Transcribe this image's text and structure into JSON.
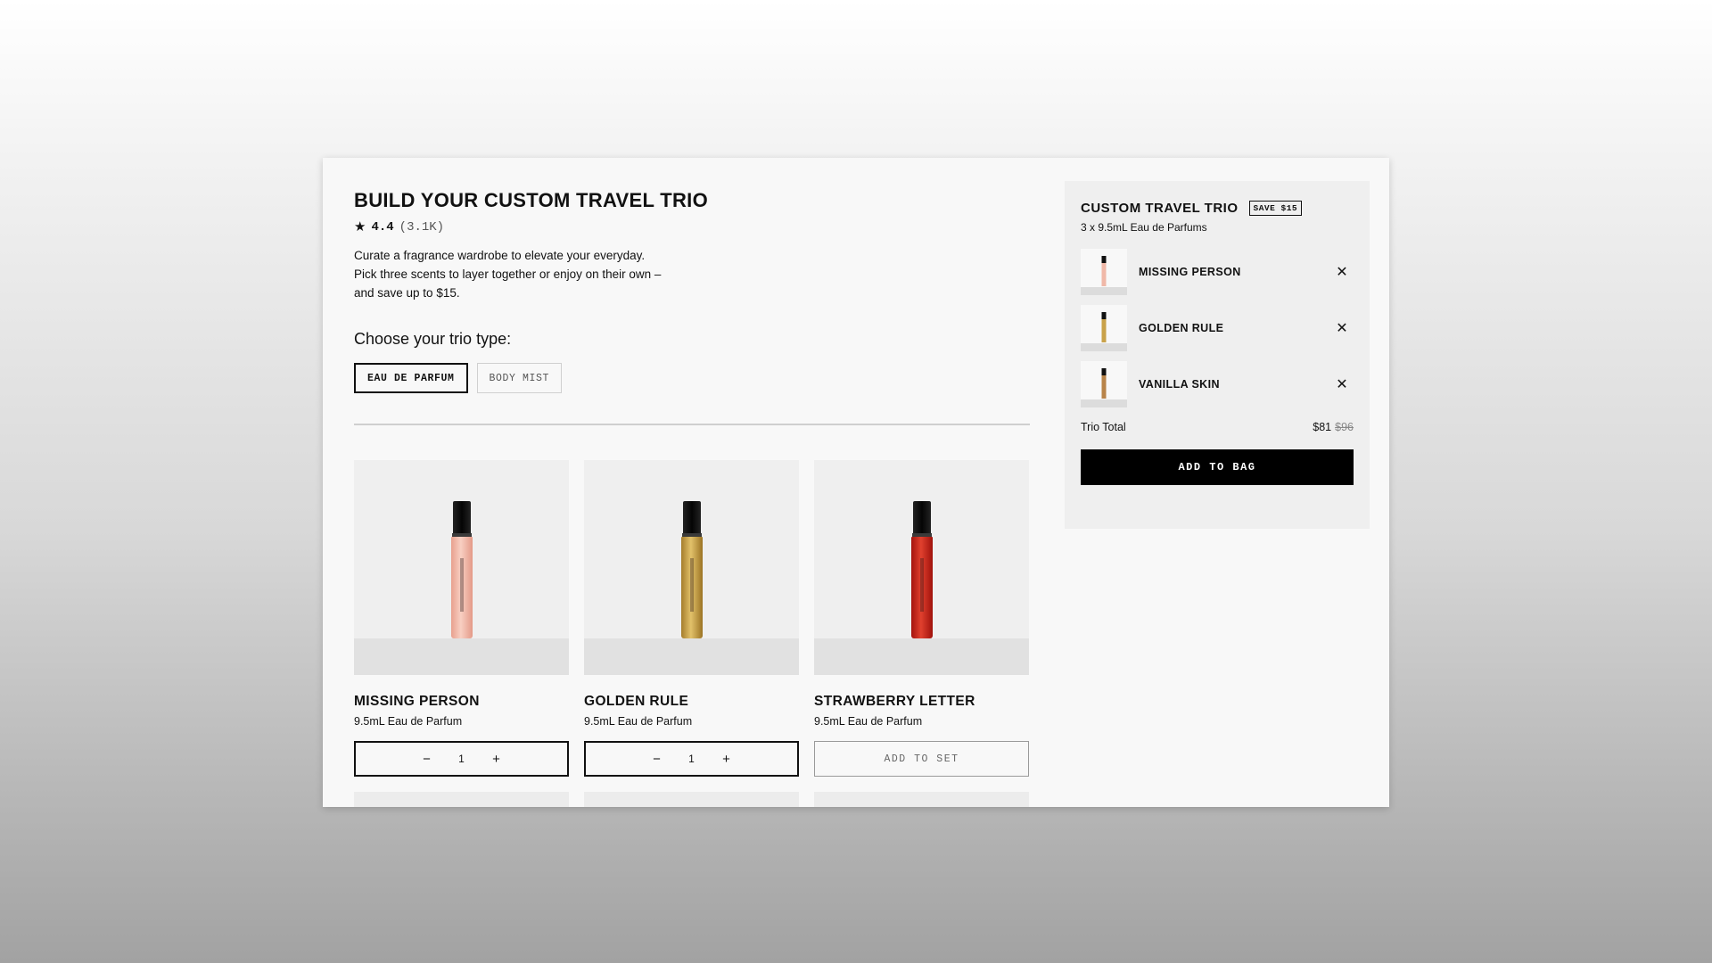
{
  "colors": {
    "accent": "#000000",
    "missing_person_bottle": "#f2b4a4",
    "golden_rule_bottle": "#c9a24a",
    "strawberry_letter_bottle": "#c8261c",
    "vanilla_skin_bottle": "#b8844a"
  },
  "builder": {
    "title": "BUILD YOUR CUSTOM TRAVEL TRIO",
    "star_icon": "star-icon",
    "rating": "4.4",
    "review_count": "(3.1K)",
    "description_line1": "Curate a fragrance wardrobe to elevate your everyday.",
    "description_line2": "Pick three scents to layer together or enjoy on their own –",
    "description_line3": "and save up to $15.",
    "choose_label": "Choose your trio type:",
    "types": [
      {
        "label": "EAU DE PARFUM",
        "selected": true
      },
      {
        "label": "BODY MIST",
        "selected": false
      }
    ]
  },
  "products": [
    {
      "name": "MISSING PERSON",
      "subtitle": "9.5mL Eau de Parfum",
      "quantity": "1",
      "minus": "−",
      "plus": "+"
    },
    {
      "name": "GOLDEN RULE",
      "subtitle": "9.5mL Eau de Parfum",
      "quantity": "1",
      "minus": "−",
      "plus": "+"
    },
    {
      "name": "STRAWBERRY LETTER",
      "subtitle": "9.5mL Eau de Parfum",
      "add_label": "ADD TO SET"
    }
  ],
  "summary": {
    "title": "CUSTOM TRAVEL TRIO",
    "badge": "SAVE $15",
    "subtitle": "3 x 9.5mL Eau de Parfums",
    "items": [
      {
        "name": "MISSING PERSON",
        "remove": "✕"
      },
      {
        "name": "GOLDEN RULE",
        "remove": "✕"
      },
      {
        "name": "VANILLA SKIN",
        "remove": "✕"
      }
    ],
    "total_label": "Trio Total",
    "total_price": "$81",
    "original_price": "$96",
    "cta": "ADD TO BAG"
  }
}
